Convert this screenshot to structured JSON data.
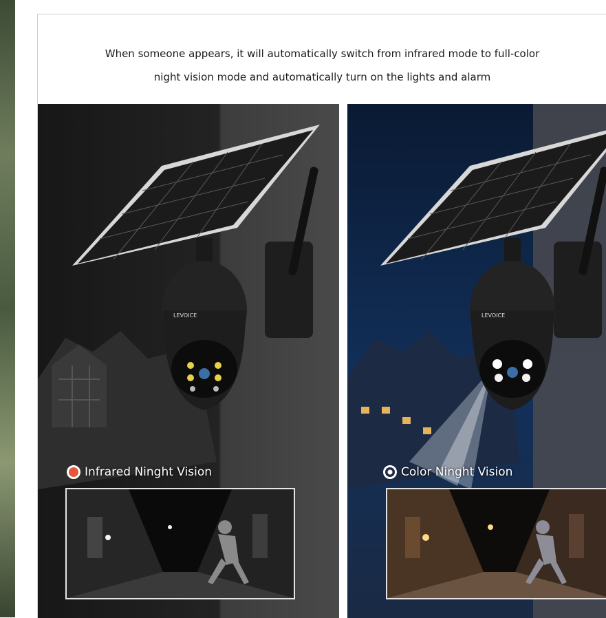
{
  "headline": {
    "line1": "When someone appears, it will automatically switch from infrared mode to full-color",
    "line2": "night vision mode and automatically turn on the lights and alarm"
  },
  "left_panel": {
    "mode_label": "Infrared Ninght Vision",
    "mode_icon": "infrared-icon",
    "camera_brand": "LEVOICE"
  },
  "right_panel": {
    "mode_label": "Color Ninght Vision",
    "mode_icon": "color-vision-icon",
    "camera_brand": "LEVOICE"
  },
  "colors": {
    "infrared_icon": "#e8553b",
    "night_sky": "#0f2a52",
    "warm_light": "#e6b25a"
  }
}
